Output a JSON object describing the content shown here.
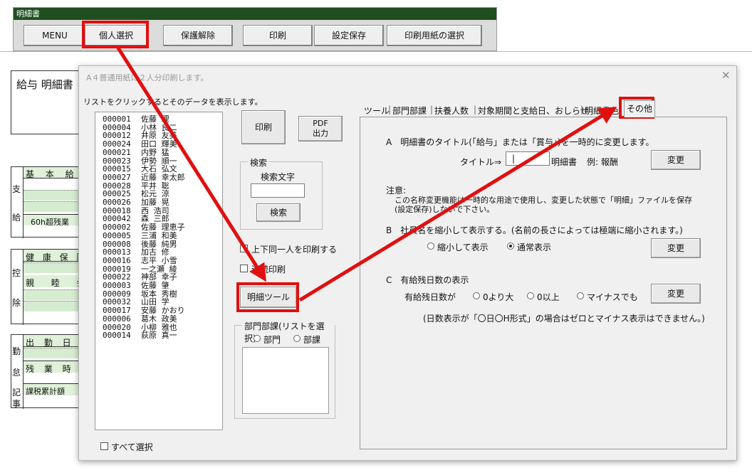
{
  "toolbar": {
    "title": "明細書",
    "buttons": [
      "MENU",
      "個人選択",
      "保護解除",
      "印刷",
      "設定保存",
      "印刷用紙の選択"
    ]
  },
  "sheet": {
    "title": "給与 明細書",
    "section_labels": [
      "支",
      "給",
      "控",
      "除",
      "勤",
      "怠",
      "記",
      "事"
    ],
    "rows": [
      "基 本 給",
      "60h超残業",
      "健 康 保 険",
      "親 睦 会",
      "出 勤 日 数",
      "残 業 時 間",
      "課税累計額"
    ]
  },
  "dialog": {
    "title": "A４普通用紙に２人分印刷します。",
    "close_icon": "close-icon",
    "list_hint": "リストをクリックするとそのデータを表示します。",
    "employees": [
      {
        "code": "000001",
        "name": "佐藤 理"
      },
      {
        "code": "000004",
        "name": "小林 良二"
      },
      {
        "code": "000012",
        "name": "井原 友美"
      },
      {
        "code": "000024",
        "name": "田口 輝美"
      },
      {
        "code": "000021",
        "name": "内野 猛"
      },
      {
        "code": "000023",
        "name": "伊勢 順一"
      },
      {
        "code": "000015",
        "name": "大石 弘文"
      },
      {
        "code": "000027",
        "name": "近藤 幸太郎"
      },
      {
        "code": "000028",
        "name": "平井 聡"
      },
      {
        "code": "000025",
        "name": "松元 涼"
      },
      {
        "code": "000026",
        "name": "加藤 晃"
      },
      {
        "code": "000018",
        "name": "西 浩司"
      },
      {
        "code": "000042",
        "name": "森 三郎"
      },
      {
        "code": "000002",
        "name": "佐藤 理恵子"
      },
      {
        "code": "000005",
        "name": "三浦 和美"
      },
      {
        "code": "000008",
        "name": "後藤 純男"
      },
      {
        "code": "000013",
        "name": "加古 修"
      },
      {
        "code": "000016",
        "name": "志平 小雪"
      },
      {
        "code": "000019",
        "name": "一之瀬 綾"
      },
      {
        "code": "000022",
        "name": "神部 幸子"
      },
      {
        "code": "000003",
        "name": "佐藤 肇"
      },
      {
        "code": "000009",
        "name": "坂本 秀樹"
      },
      {
        "code": "000032",
        "name": "山田 学"
      },
      {
        "code": "000017",
        "name": "安藤 かおり"
      },
      {
        "code": "000006",
        "name": "葛木 政美"
      },
      {
        "code": "000020",
        "name": "小柳 雅也"
      },
      {
        "code": "000014",
        "name": "荻原 真一"
      }
    ],
    "select_all_label": "すべて選択",
    "print_label": "印刷",
    "pdf_label_1": "PDF",
    "pdf_label_2": "出力",
    "search": {
      "group_title": "検索",
      "field_label": "検索文字",
      "value": "",
      "button_label": "検索"
    },
    "same_person_label": "上下同一人を印刷する",
    "continuous_label": "連続印刷",
    "meisai_tool_label": "明細ツール",
    "dept": {
      "group_title": "部門部課(リストを選択)",
      "radio_1": "部門",
      "radio_2": "部課"
    },
    "tabs": [
      "ツール",
      "部門部課",
      "扶養人数",
      "対象期間と支給日、おしらせ",
      "明細書色",
      "その他"
    ],
    "active_tab": "その他",
    "panel": {
      "a_title": "A　明細書のタイトル(「給与」または「賞与」)を一時的に変更します。",
      "title_label": "タイトル⇒",
      "title_value": "|",
      "title_suffix": "明細書",
      "example": "例: 報酬",
      "change": "変更",
      "note_title": "注意:",
      "note_line_1": "この名称変更機能は一時的な用途で使用し、変更した状態で「明細」ファイルを保存",
      "note_line_2": "(設定保存)しないで下さい。",
      "b_title": "B　社員名を縮小して表示する。(名前の長さによっては極端に縮小されます。)",
      "b_opt_1": "縮小して表示",
      "b_opt_2": "通常表示",
      "b_selected": "通常表示",
      "c_title": "C　有給残日数の表示",
      "c_label": "有給残日数が",
      "c_opt_1": "0より大",
      "c_opt_2": "0以上",
      "c_opt_3": "マイナスでも",
      "c_note": "(日数表示が「〇日〇H形式」の場合はゼロとマイナス表示はできません。)"
    }
  },
  "annotation_color": "#e01010"
}
